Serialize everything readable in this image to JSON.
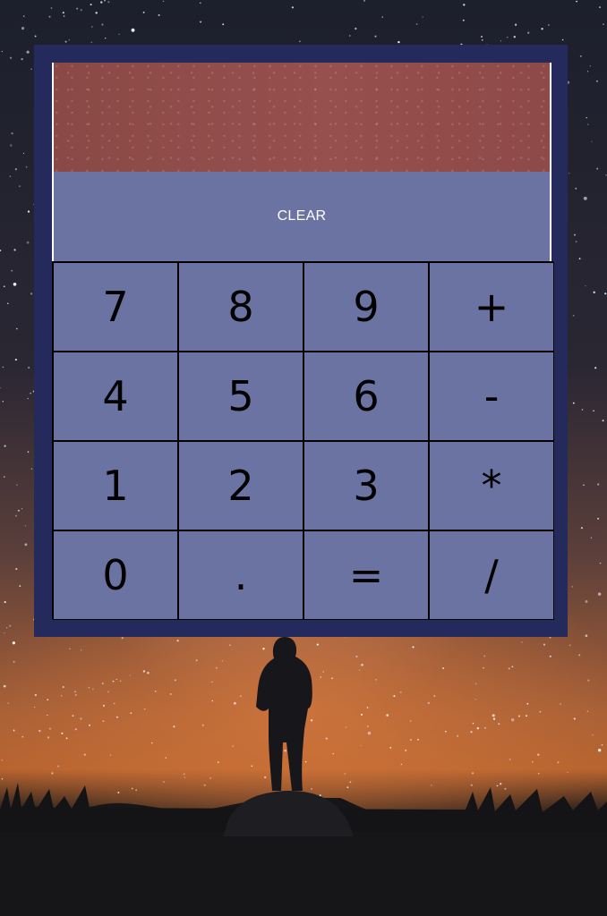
{
  "display": {
    "value": ""
  },
  "clear_button": {
    "label": "CLEAR"
  },
  "keys": [
    {
      "label": "7",
      "name": "key-7"
    },
    {
      "label": "8",
      "name": "key-8"
    },
    {
      "label": "9",
      "name": "key-9"
    },
    {
      "label": "+",
      "name": "key-plus"
    },
    {
      "label": "4",
      "name": "key-4"
    },
    {
      "label": "5",
      "name": "key-5"
    },
    {
      "label": "6",
      "name": "key-6"
    },
    {
      "label": "-",
      "name": "key-minus"
    },
    {
      "label": "1",
      "name": "key-1"
    },
    {
      "label": "2",
      "name": "key-2"
    },
    {
      "label": "3",
      "name": "key-3"
    },
    {
      "label": "*",
      "name": "key-multiply"
    },
    {
      "label": "0",
      "name": "key-0"
    },
    {
      "label": ".",
      "name": "key-decimal"
    },
    {
      "label": "=",
      "name": "key-equals"
    },
    {
      "label": "/",
      "name": "key-divide"
    }
  ],
  "colors": {
    "frame": "#242a5c",
    "key_background": "#6a73a1",
    "display_background": "#8f4b49"
  }
}
